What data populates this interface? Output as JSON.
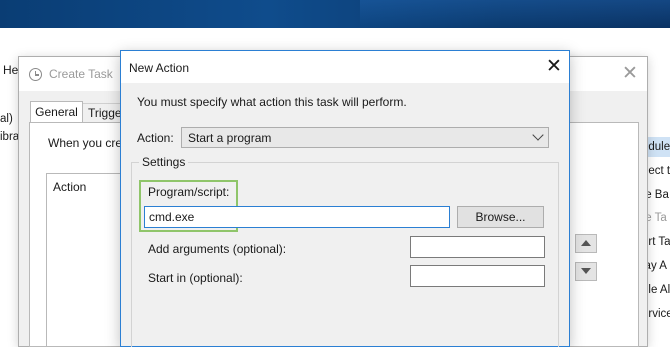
{
  "background_app": {
    "menu_help": "Hel",
    "left_panel_items": [
      "al)",
      "ibra"
    ],
    "right_panel_items": [
      "edule",
      "nect t",
      "te Ba",
      "te Ta",
      "ort Ta",
      "lay A",
      "ble Al",
      "ervice"
    ]
  },
  "create_task": {
    "title": "Create Task",
    "tabs": [
      "General",
      "Trigge"
    ],
    "description_snippet": "When you cre",
    "action_column_header": "Action"
  },
  "new_action": {
    "title": "New Action",
    "instruction": "You must specify what action this task will perform.",
    "action_label": "Action:",
    "action_value": "Start a program",
    "settings_legend": "Settings",
    "program_label": "Program/script:",
    "program_value": "cmd.exe",
    "browse_label": "Browse...",
    "arguments_label": "Add arguments (optional):",
    "arguments_value": "",
    "start_in_label": "Start in (optional):",
    "start_in_value": ""
  },
  "colors": {
    "accent": "#2b7fd3",
    "highlight": "#8fc56a",
    "wallpaper": "#0f4c8c"
  },
  "icons": {
    "close": "close-icon",
    "clock": "clock-icon",
    "dropdown": "chevron-down-icon"
  }
}
